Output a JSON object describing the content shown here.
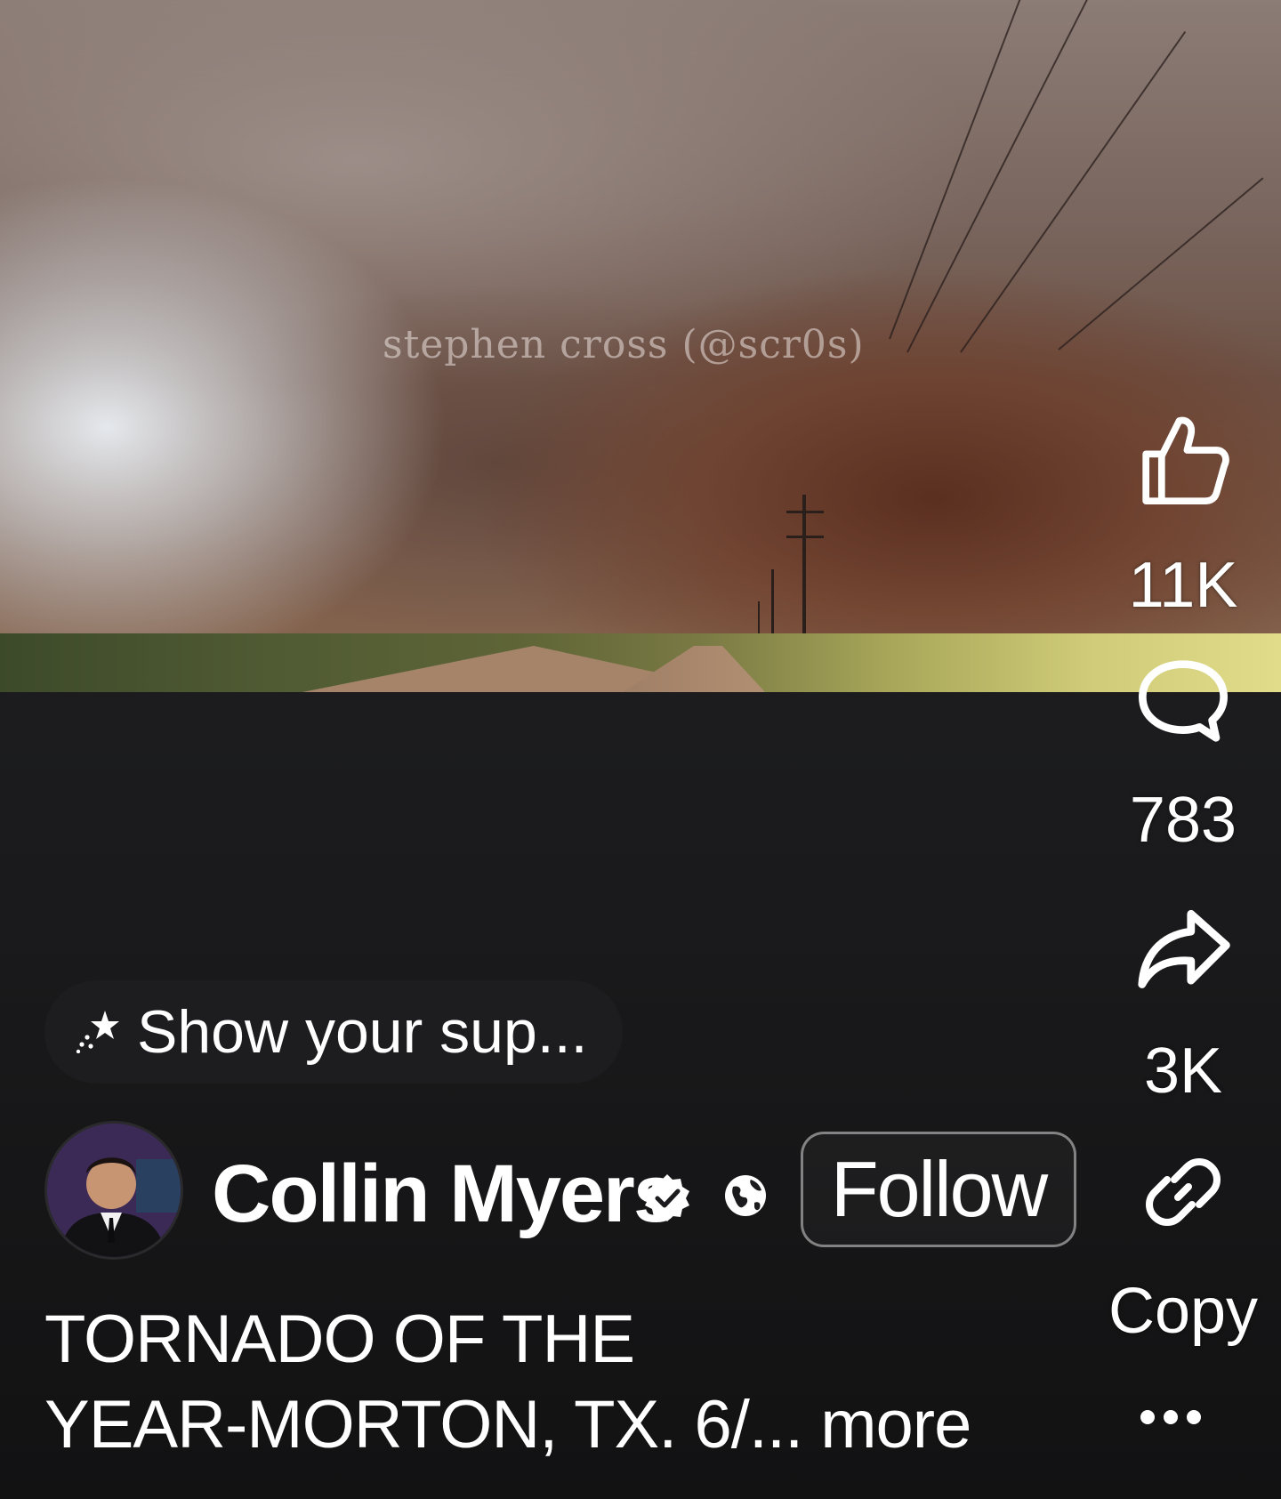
{
  "video": {
    "watermark": "stephen cross (@scr0s)"
  },
  "actions": {
    "like": {
      "icon": "thumbs-up-icon",
      "count": "11K"
    },
    "comment": {
      "icon": "comment-bubble-icon",
      "count": "783"
    },
    "share": {
      "icon": "share-arrow-icon",
      "count": "3K"
    },
    "copy": {
      "icon": "link-icon",
      "label": "Copy"
    },
    "more": {
      "icon": "more-dots-icon"
    }
  },
  "support": {
    "icon": "sparkle-star-icon",
    "label": "Show your sup..."
  },
  "channel": {
    "name": "Collin Myers",
    "verified_icon": "verified-badge-icon",
    "visibility_icon": "globe-icon",
    "follow_label": "Follow"
  },
  "post": {
    "title_line1": "TORNADO OF THE",
    "title_line2": "YEAR-MORTON, TX. 6/...",
    "more_label": "more"
  },
  "colors": {
    "background": "#1a1a1c",
    "text": "#ffffff",
    "chip": "#1e1e20"
  }
}
